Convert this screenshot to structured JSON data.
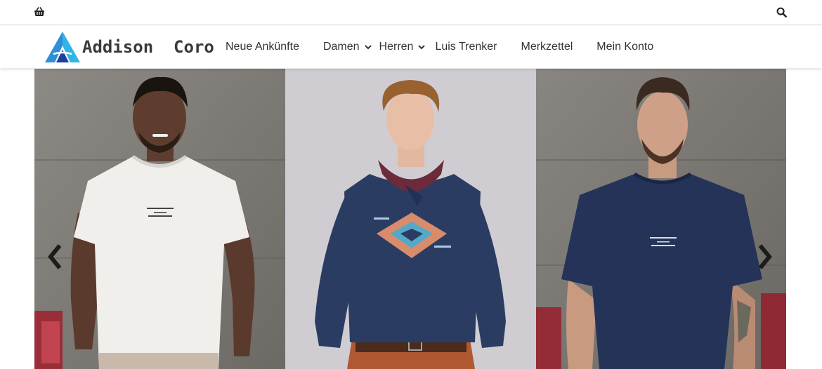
{
  "topbar": {
    "cart_icon": "shopping-basket-icon",
    "search_icon": "search-icon"
  },
  "header": {
    "logo_text": "Addison  Coro",
    "logo_colors": {
      "blue": "#2d8fd6",
      "cyan": "#32b4e6",
      "navy": "#1f3f9a"
    },
    "nav": [
      {
        "label": "Neue Ankünfte",
        "has_dropdown": false
      },
      {
        "label": "Damen",
        "has_dropdown": true
      },
      {
        "label": "Herren",
        "has_dropdown": true
      },
      {
        "label": "Luis Trenker",
        "has_dropdown": false
      },
      {
        "label": "Merkzettel",
        "has_dropdown": false
      },
      {
        "label": "Mein Konto",
        "has_dropdown": false
      }
    ]
  },
  "hero": {
    "slides": [
      {
        "shirt_print": [
          "LUIS TRENKER",
          "1893",
          "FC SÜDTIROL"
        ],
        "shirt_color": "#f1efec"
      },
      {
        "shirt_print": [
          "Luis Trenker"
        ],
        "shirt_color": "#2b3c63"
      },
      {
        "shirt_print": [
          "LUIS TRENKER",
          "1893",
          "FC SÜDTIROL"
        ],
        "shirt_color": "#253358"
      }
    ],
    "prev_icon": "chevron-left-icon",
    "next_icon": "chevron-right-icon"
  }
}
